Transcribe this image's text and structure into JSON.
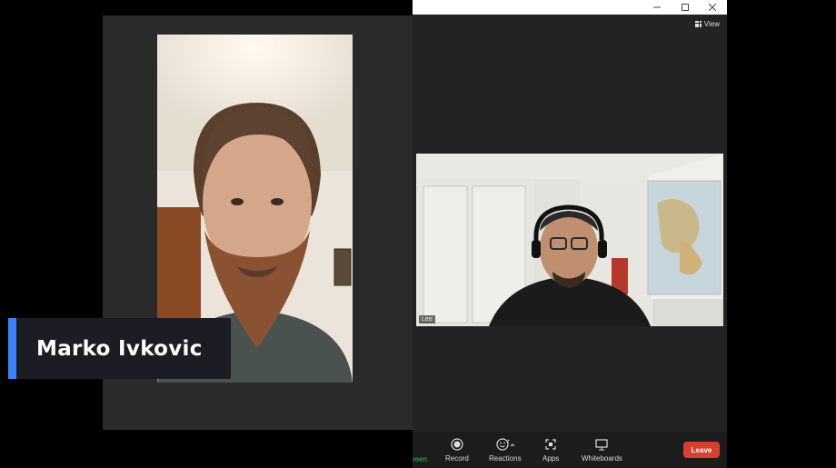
{
  "zoom": {
    "view_label": "View",
    "participant_leo": "Leo",
    "toolbar": {
      "share_fragment": "reen",
      "record": "Record",
      "reactions": "Reactions",
      "apps": "Apps",
      "whiteboards": "Whiteboards",
      "leave": "Leave"
    },
    "window_controls": [
      "minimize-icon",
      "maximize-icon",
      "close-icon"
    ]
  },
  "overlay": {
    "name": "Marko Ivkovic",
    "accent_color": "#3b82f6"
  },
  "colors": {
    "leave": "#d6402f",
    "toolbar_bg": "#1c1c1c",
    "meeting_bg": "#232323"
  }
}
